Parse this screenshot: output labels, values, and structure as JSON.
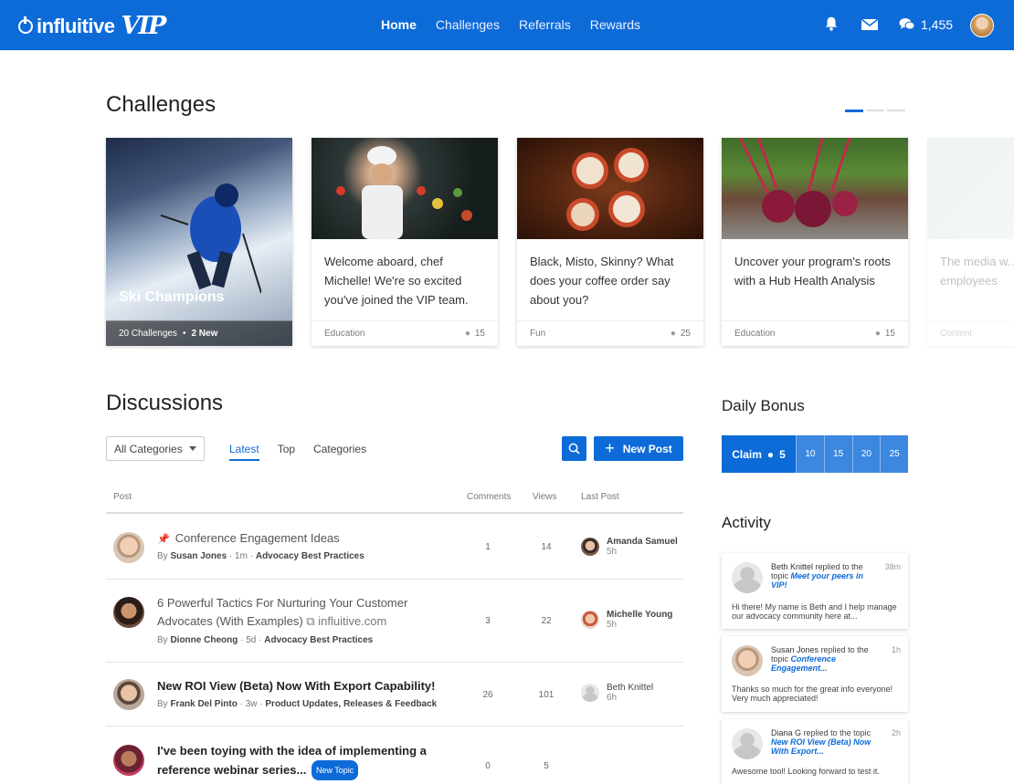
{
  "brand": {
    "name": "influitive",
    "tier": "VIP"
  },
  "nav": {
    "items": [
      "Home",
      "Challenges",
      "Referrals",
      "Rewards"
    ],
    "active": "Home"
  },
  "header": {
    "points": "1,455"
  },
  "challenges": {
    "title": "Challenges",
    "featured": {
      "title": "Ski Champions",
      "count": "20 Challenges",
      "new": "2 New"
    },
    "cards": [
      {
        "text": "Welcome aboard, chef Michelle! We're so excited you've joined the VIP team.",
        "category": "Education",
        "points": "15"
      },
      {
        "text": "Black, Misto, Skinny? What does your coffee order say about you?",
        "category": "Fun",
        "points": "25"
      },
      {
        "text": "Uncover your program's roots with a Hub Health Analysis",
        "category": "Education",
        "points": "15"
      },
      {
        "text": "The media w... interview? In employees",
        "category": "Content",
        "points": ""
      }
    ]
  },
  "discussions": {
    "title": "Discussions",
    "filter": "All Categories",
    "tabs": [
      "Latest",
      "Top",
      "Categories"
    ],
    "new_post": "New Post",
    "columns": {
      "post": "Post",
      "comments": "Comments",
      "views": "Views",
      "last_post": "Last Post"
    },
    "rows": [
      {
        "title": "Conference Engagement Ideas",
        "by": "By",
        "author": "Susan Jones",
        "age": "1m",
        "category": "Advocacy Best Practices",
        "comments": "1",
        "views": "14",
        "last_name": "Amanda Samuel",
        "last_time": "5h"
      },
      {
        "title": "6 Powerful Tactics For Nurturing Your Customer Advocates (With Examples)",
        "link": "influitive.com",
        "by": "By",
        "author": "Dionne Cheong",
        "age": "5d",
        "category": "Advocacy Best Practices",
        "comments": "3",
        "views": "22",
        "last_name": "Michelle Young",
        "last_time": "5h"
      },
      {
        "title": "New ROI View (Beta) Now With Export Capability!",
        "by": "By",
        "author": "Frank Del Pinto",
        "age": "3w",
        "category": "Product Updates, Releases & Feedback",
        "comments": "26",
        "views": "101",
        "last_name": "Beth Knittel",
        "last_time": "6h"
      },
      {
        "title": "I've been toying with the idea of implementing a reference webinar series...",
        "badge": "New Topic",
        "comments": "0",
        "views": "5"
      }
    ]
  },
  "daily_bonus": {
    "title": "Daily Bonus",
    "claim": "Claim",
    "claim_points": "5",
    "steps": [
      "10",
      "15",
      "20",
      "25"
    ]
  },
  "activity": {
    "title": "Activity",
    "items": [
      {
        "who": "Beth Knittel",
        "action": "replied to the topic",
        "topic": "Meet your peers in VIP!",
        "time": "38m",
        "text": "Hi there! My name is Beth and I help manage our advocacy community here at..."
      },
      {
        "who": "Susan Jones",
        "action": "replied to the topic",
        "topic": "Conference Engagement...",
        "time": "1h",
        "text": "Thanks so much for the great info everyone! Very much appreciated!"
      },
      {
        "who": "Diana G",
        "action": "replied to the topic",
        "topic": "New ROI View (Beta) Now With Export...",
        "time": "2h",
        "text": "Awesome tool! Looking forward to test it."
      }
    ]
  },
  "colors": {
    "brand_blue": "#0d6bd8",
    "step_blue": "#3c87e0"
  }
}
